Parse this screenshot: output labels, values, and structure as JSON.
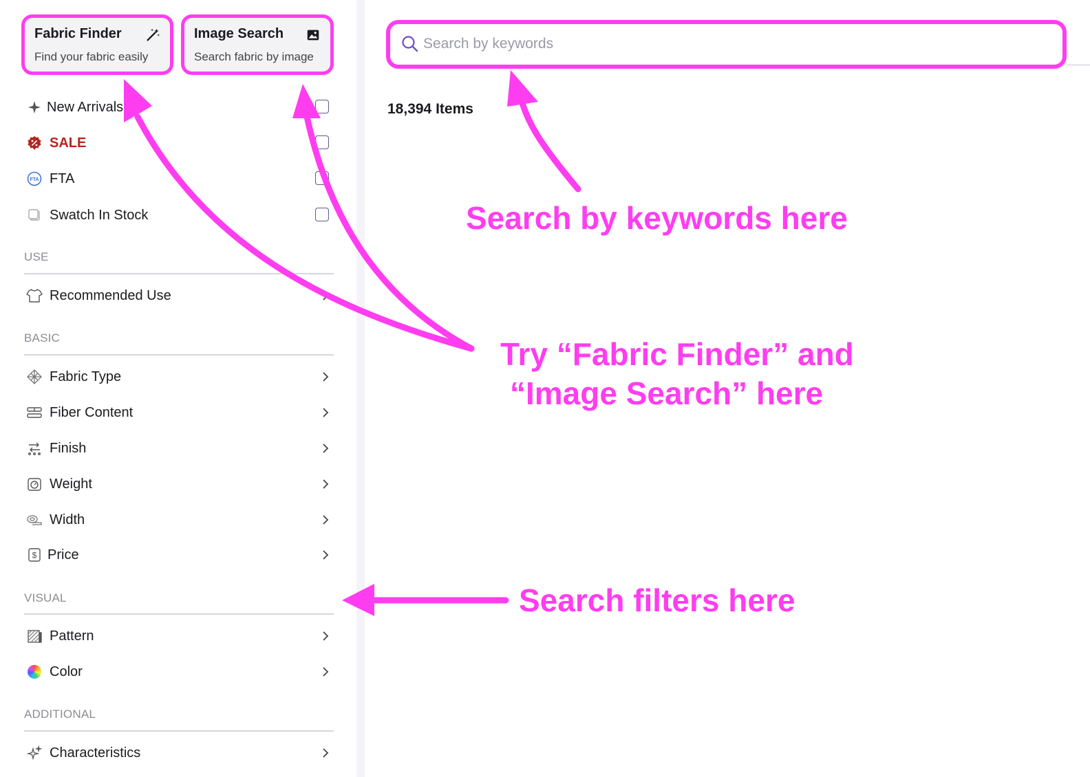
{
  "cards": {
    "finder": {
      "title": "Fabric Finder",
      "subtitle": "Find your fabric easily",
      "icon": "magic-wand-icon"
    },
    "image": {
      "title": "Image Search",
      "subtitle": "Search fabric by image",
      "icon": "image-icon"
    }
  },
  "toggles": [
    {
      "label": "New Arrivals",
      "icon": "sparkle-icon",
      "checked": false
    },
    {
      "label": "SALE",
      "icon": "sale-badge-icon",
      "checked": false
    },
    {
      "label": "FTA",
      "icon": "fta-icon",
      "checked": false
    },
    {
      "label": "Swatch In Stock",
      "icon": "swatch-icon",
      "checked": false
    }
  ],
  "sections": {
    "use": "USE",
    "basic": "BASIC",
    "visual": "VISUAL",
    "additional": "ADDITIONAL"
  },
  "filters": {
    "use": [
      {
        "label": "Recommended Use",
        "icon": "shirt-icon"
      }
    ],
    "basic": [
      {
        "label": "Fabric Type",
        "icon": "weave-icon"
      },
      {
        "label": "Fiber Content",
        "icon": "fiber-icon"
      },
      {
        "label": "Finish",
        "icon": "finish-icon"
      },
      {
        "label": "Weight",
        "icon": "weight-icon"
      },
      {
        "label": "Width",
        "icon": "tape-measure-icon"
      },
      {
        "label": "Price",
        "icon": "dollar-icon"
      }
    ],
    "visual": [
      {
        "label": "Pattern",
        "icon": "pattern-icon"
      },
      {
        "label": "Color",
        "icon": "color-wheel-icon"
      }
    ],
    "additional": [
      {
        "label": "Characteristics",
        "icon": "sparkles-icon"
      }
    ]
  },
  "search": {
    "placeholder": "Search by keywords",
    "value": ""
  },
  "results": {
    "count_text": "18,394 Items"
  },
  "annotations": {
    "keywords": "Search by keywords here",
    "try_line1": "Try “Fabric Finder” and",
    "try_line2": "“Image Search” here",
    "filters": "Search filters here"
  },
  "colors": {
    "highlight": "#ff3df0",
    "sale": "#b3261e",
    "accent": "#6b4fc9"
  }
}
